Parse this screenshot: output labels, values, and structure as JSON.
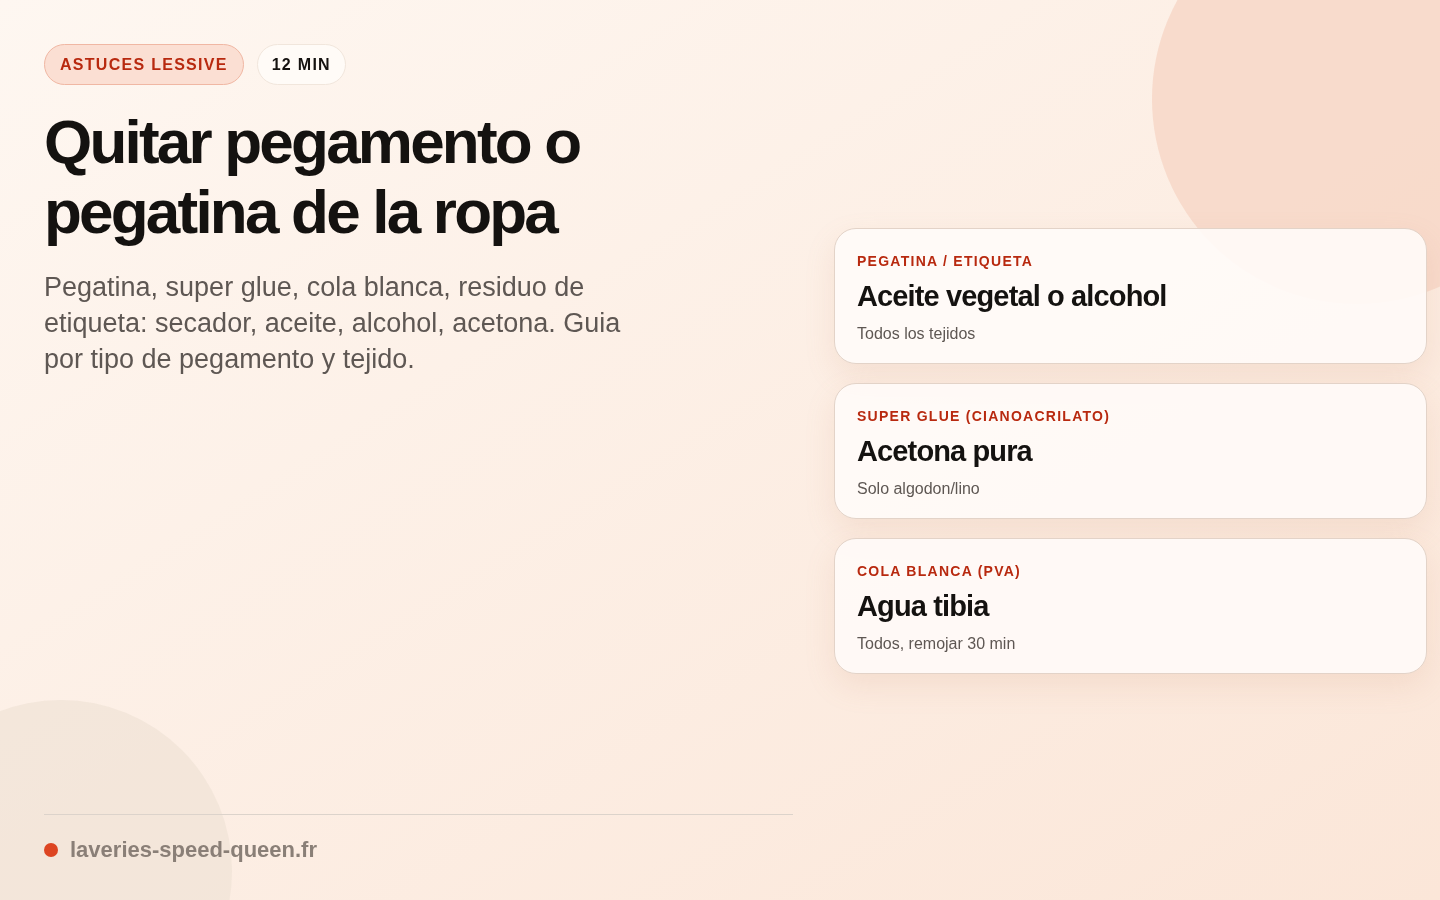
{
  "tags": [
    {
      "label": "ASTUCES LESSIVE",
      "kind": "category"
    },
    {
      "label": "12 MIN",
      "kind": "duration"
    }
  ],
  "title": "Quitar pegamento o pegatina de la ropa",
  "subtitle": "Pegatina, super glue, cola blanca, residuo de etiqueta: secador, aceite, alcohol, acetona. Guia por tipo de pegamento y tejido.",
  "cards": [
    {
      "label": "PEGATINA / ETIQUETA",
      "title": "Aceite vegetal o alcohol",
      "note": "Todos los tejidos"
    },
    {
      "label": "SUPER GLUE (CIANOACRILATO)",
      "title": "Acetona pura",
      "note": "Solo algodon/lino"
    },
    {
      "label": "COLA BLANCA (PVA)",
      "title": "Agua tibia",
      "note": "Todos, remojar 30 min"
    }
  ],
  "footer": {
    "site": "laveries-speed-queen.fr"
  }
}
